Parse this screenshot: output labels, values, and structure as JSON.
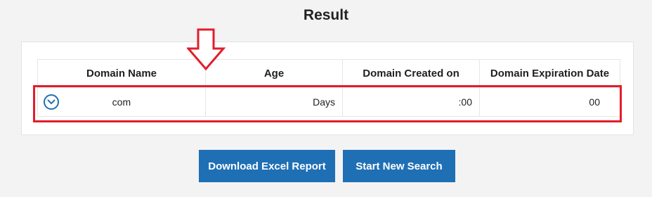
{
  "page": {
    "title": "Result"
  },
  "table": {
    "headers": [
      "Domain Name",
      "Age",
      "Domain Created on",
      "Domain Expiration Date"
    ],
    "rows": [
      {
        "domain": "com",
        "age": "Days",
        "created": ":00",
        "expiration": "00"
      }
    ]
  },
  "buttons": {
    "download": "Download Excel Report",
    "new_search": "Start New Search"
  },
  "colors": {
    "accent": "#1f6fb5",
    "annotation": "#e21d2c"
  },
  "icons": [
    "expand-row-icon",
    "down-arrow-annotation-icon"
  ]
}
